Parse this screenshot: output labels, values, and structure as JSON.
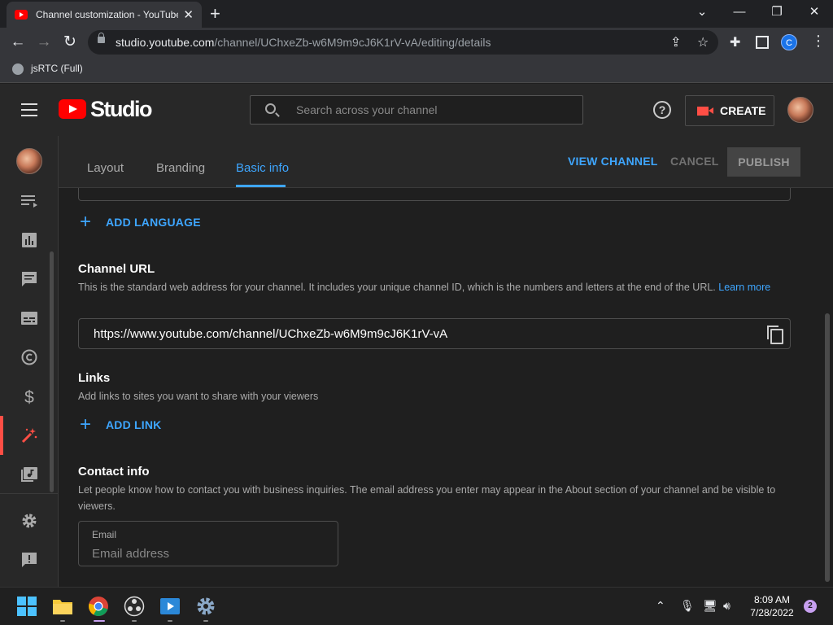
{
  "browser": {
    "tab_title": "Channel customization - YouTube",
    "url_host": "studio.youtube.com",
    "url_path": "/channel/UChxeZb-w6M9m9cJ6K1rV-vA/editing/details",
    "profile_initial": "C",
    "bookmark_label": "jsRTC (Full)"
  },
  "header": {
    "logo_text": "Studio",
    "search_placeholder": "Search across your channel",
    "help_glyph": "?",
    "create_label": "CREATE"
  },
  "tabs": {
    "layout": "Layout",
    "branding": "Branding",
    "basic_info": "Basic info"
  },
  "actions": {
    "view_channel": "VIEW CHANNEL",
    "cancel": "CANCEL",
    "publish": "PUBLISH"
  },
  "add_language_label": "ADD LANGUAGE",
  "channel_url": {
    "title": "Channel URL",
    "description": "This is the standard web address for your channel. It includes your unique channel ID, which is the numbers and letters at the end of the URL.",
    "learn_more": "Learn more",
    "value": "https://www.youtube.com/channel/UChxeZb-w6M9m9cJ6K1rV-vA"
  },
  "links": {
    "title": "Links",
    "description": "Add links to sites you want to share with your viewers",
    "add_label": "ADD LINK"
  },
  "contact": {
    "title": "Contact info",
    "description": "Let people know how to contact you with business inquiries. The email address you enter may appear in the About section of your channel and be visible to viewers.",
    "email_label": "Email",
    "email_placeholder": "Email address"
  },
  "taskbar": {
    "time": "8:09 AM",
    "date": "7/28/2022",
    "notification_count": "2"
  },
  "colors": {
    "accent_blue": "#3ea6ff",
    "brand_red": "#ff0000",
    "active_red": "#ff4e45"
  }
}
